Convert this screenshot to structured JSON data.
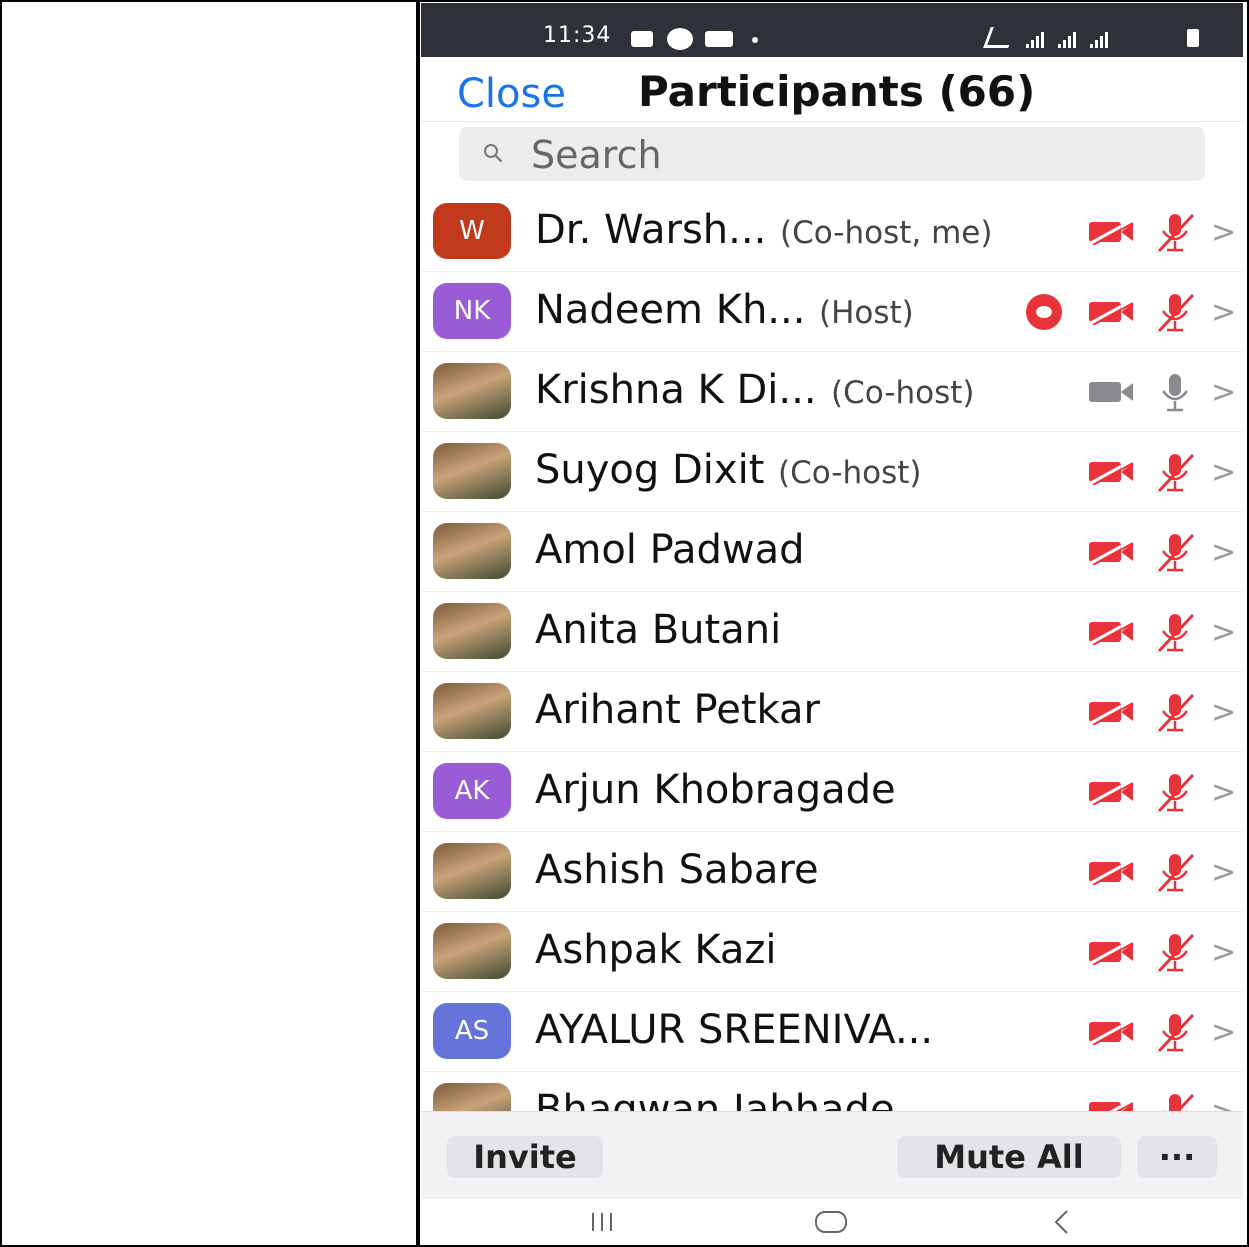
{
  "status": {
    "time": "11:34"
  },
  "header": {
    "close_label": "Close",
    "title": "Participants (66)"
  },
  "search": {
    "placeholder": "Search"
  },
  "colors": {
    "accent": "#1a73e8",
    "muted_red": "#e8333a",
    "rec": "#e8333a"
  },
  "participants": [
    {
      "initials": "W",
      "name": "Dr. Warsh...",
      "role": "(Co-host, me)",
      "avatar_color": "#c0391b",
      "video": "off",
      "audio": "muted",
      "recording": false
    },
    {
      "initials": "NK",
      "name": "Nadeem Kh...",
      "role": "(Host)",
      "avatar_color": "#9a5bd6",
      "video": "off",
      "audio": "muted",
      "recording": true
    },
    {
      "initials": "",
      "name": "Krishna K Di...",
      "role": "(Co-host)",
      "avatar_color": "photo",
      "video": "on",
      "audio": "on",
      "recording": false
    },
    {
      "initials": "",
      "name": "Suyog Dixit",
      "role": "(Co-host)",
      "avatar_color": "photo",
      "video": "off",
      "audio": "muted",
      "recording": false
    },
    {
      "initials": "",
      "name": "Amol Padwad",
      "role": "",
      "avatar_color": "photo",
      "video": "off",
      "audio": "muted",
      "recording": false
    },
    {
      "initials": "",
      "name": "Anita Butani",
      "role": "",
      "avatar_color": "photo",
      "video": "off",
      "audio": "muted",
      "recording": false
    },
    {
      "initials": "",
      "name": "Arihant Petkar",
      "role": "",
      "avatar_color": "photo",
      "video": "off",
      "audio": "muted",
      "recording": false
    },
    {
      "initials": "AK",
      "name": "Arjun Khobragade",
      "role": "",
      "avatar_color": "#9a5bd6",
      "video": "off",
      "audio": "muted",
      "recording": false
    },
    {
      "initials": "",
      "name": "Ashish Sabare",
      "role": "",
      "avatar_color": "photo",
      "video": "off",
      "audio": "muted",
      "recording": false
    },
    {
      "initials": "",
      "name": "Ashpak Kazi",
      "role": "",
      "avatar_color": "photo",
      "video": "off",
      "audio": "muted",
      "recording": false
    },
    {
      "initials": "AS",
      "name": "AYALUR SREENIVA...",
      "role": "",
      "avatar_color": "#6673d8",
      "video": "off",
      "audio": "muted",
      "recording": false
    },
    {
      "initials": "",
      "name": "Bhagwan Jabhade",
      "role": "",
      "avatar_color": "photo",
      "video": "off",
      "audio": "muted",
      "recording": false
    }
  ],
  "footer": {
    "invite_label": "Invite",
    "mute_all_label": "Mute All",
    "more_label": "···"
  }
}
